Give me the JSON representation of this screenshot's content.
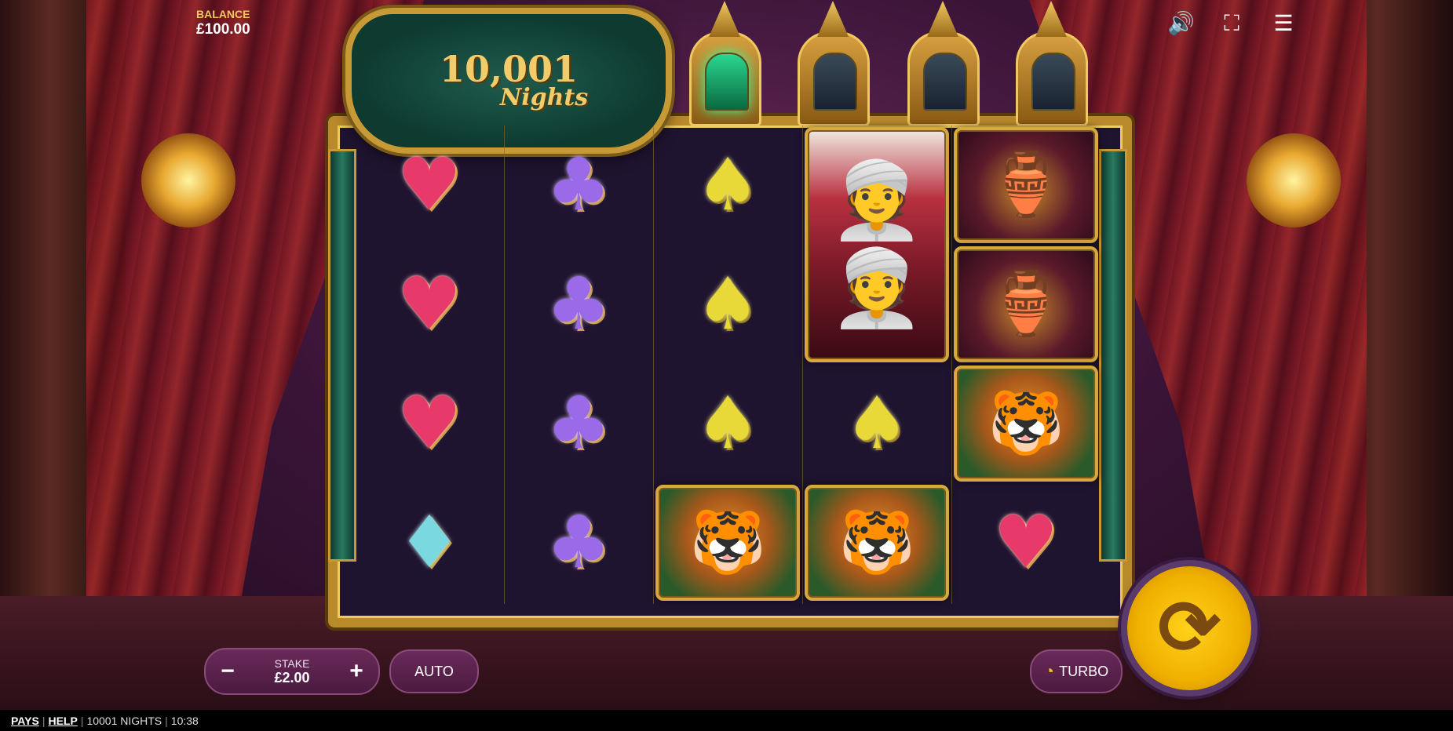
{
  "hud": {
    "balance_label": "BALANCE",
    "balance_value": "£100.00",
    "icons": [
      "sound-icon",
      "fullscreen-icon",
      "menu-icon"
    ]
  },
  "logo": {
    "line1": "10,001",
    "line2": "Nights"
  },
  "lamps": [
    {
      "state": "lit"
    },
    {
      "state": "unlit"
    },
    {
      "state": "unlit"
    },
    {
      "state": "unlit"
    }
  ],
  "reels": [
    [
      "heart",
      "heart",
      "heart",
      "diamond"
    ],
    [
      "club",
      "club",
      "club",
      "club"
    ],
    [
      "spade",
      "spade",
      "spade",
      "tiger"
    ],
    [
      "sultan",
      "sultan",
      "spade",
      "tiger"
    ],
    [
      "vase",
      "vase",
      "tiger",
      "heart"
    ]
  ],
  "controls": {
    "stake_label": "STAKE",
    "stake_value": "£2.00",
    "minus": "−",
    "plus": "+",
    "auto_label": "AUTO",
    "turbo_label": "TURBO"
  },
  "footer": {
    "pays": "PAYS",
    "help": "HELP",
    "game_name": "10001 NIGHTS",
    "time": "10:38"
  },
  "colors": {
    "accent_gold": "#c89a36",
    "spin_yellow": "#f0b000",
    "button_purple": "#5a2050"
  }
}
